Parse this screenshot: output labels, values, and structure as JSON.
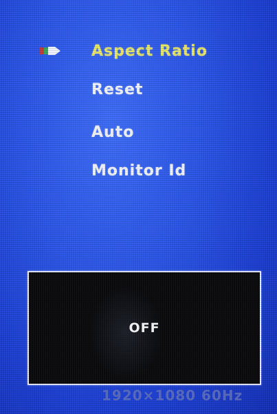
{
  "menu": {
    "items": [
      {
        "label": "Aspect  Ratio",
        "selected": true
      },
      {
        "label": "Reset",
        "selected": false
      },
      {
        "label": "Auto",
        "selected": false
      },
      {
        "label": "Monitor  Id",
        "selected": false
      }
    ],
    "selector_icon": "arrow-pointer-icon"
  },
  "value_panel": {
    "value": "OFF"
  },
  "status": {
    "resolution": "1920×1080 60Hz"
  },
  "colors": {
    "background": "#2b55e6",
    "selected_text": "#e7e66a",
    "text": "#f2f4ff",
    "panel": "#0a0a0d",
    "selector_red": "#c23b3b",
    "selector_green": "#3aa65a"
  }
}
